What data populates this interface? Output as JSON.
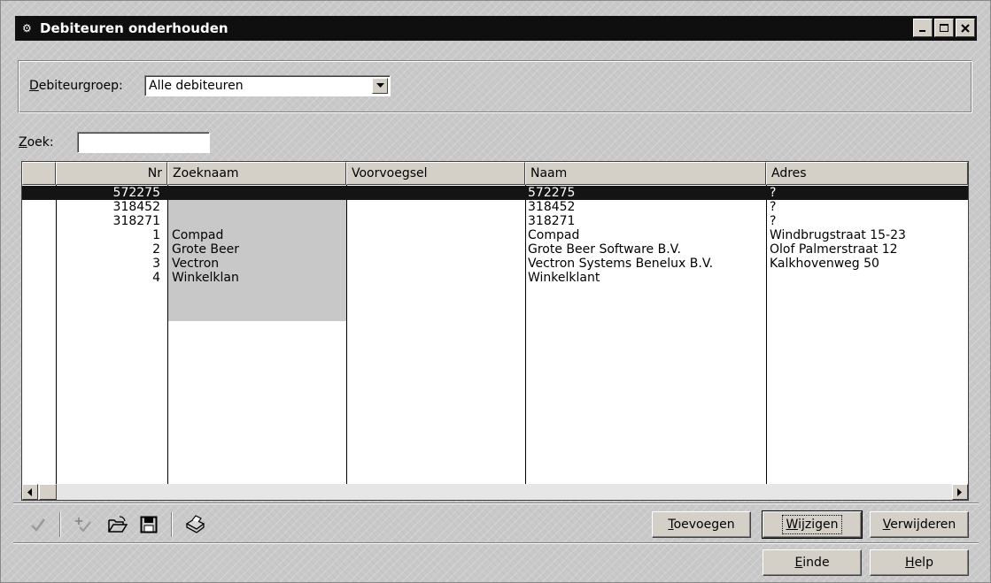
{
  "window": {
    "title": "Debiteuren onderhouden",
    "icon": "app-icon"
  },
  "filter": {
    "group_label_accel": "D",
    "group_label_rest": "ebiteurgroep:",
    "group_value": "Alle debiteuren",
    "search_label_accel": "Z",
    "search_label_rest": "oek:",
    "search_value": ""
  },
  "grid": {
    "headers": {
      "nr": "Nr",
      "zoeknaam": "Zoeknaam",
      "voorvoegsel": "Voorvoegsel",
      "naam": "Naam",
      "adres": "Adres"
    },
    "rows": [
      {
        "nr": "572275",
        "zoeknaam": "",
        "voorvoegsel": "",
        "naam": "572275",
        "adres": "?"
      },
      {
        "nr": "318452",
        "zoeknaam": "",
        "voorvoegsel": "",
        "naam": "318452",
        "adres": "?"
      },
      {
        "nr": "318271",
        "zoeknaam": "",
        "voorvoegsel": "",
        "naam": "318271",
        "adres": "?"
      },
      {
        "nr": "1",
        "zoeknaam": "Compad",
        "voorvoegsel": "",
        "naam": "Compad",
        "adres": "Windbrugstraat 15-23"
      },
      {
        "nr": "2",
        "zoeknaam": "Grote Beer",
        "voorvoegsel": "",
        "naam": "Grote Beer Software B.V.",
        "adres": "Olof Palmerstraat 12"
      },
      {
        "nr": "3",
        "zoeknaam": "Vectron",
        "voorvoegsel": "",
        "naam": "Vectron Systems Benelux B.V.",
        "adres": "Kalkhovenweg 50"
      },
      {
        "nr": "4",
        "zoeknaam": "Winkelklan",
        "voorvoegsel": "",
        "naam": "Winkelklant",
        "adres": ""
      }
    ]
  },
  "toolbar": {
    "icons": [
      "checkmark-icon",
      "check-add-icon",
      "open-folder-icon",
      "save-disk-icon",
      "print-icon"
    ]
  },
  "buttons": {
    "toevoegen": {
      "accel": "T",
      "rest": "oevoegen"
    },
    "wijzigen": {
      "accel": "W",
      "rest": "ijzigen"
    },
    "verwijderen": {
      "accel": "V",
      "rest": "erwijderen"
    },
    "einde": {
      "accel": "E",
      "rest": "inde"
    },
    "help": {
      "accel": "H",
      "rest": "elp"
    }
  }
}
